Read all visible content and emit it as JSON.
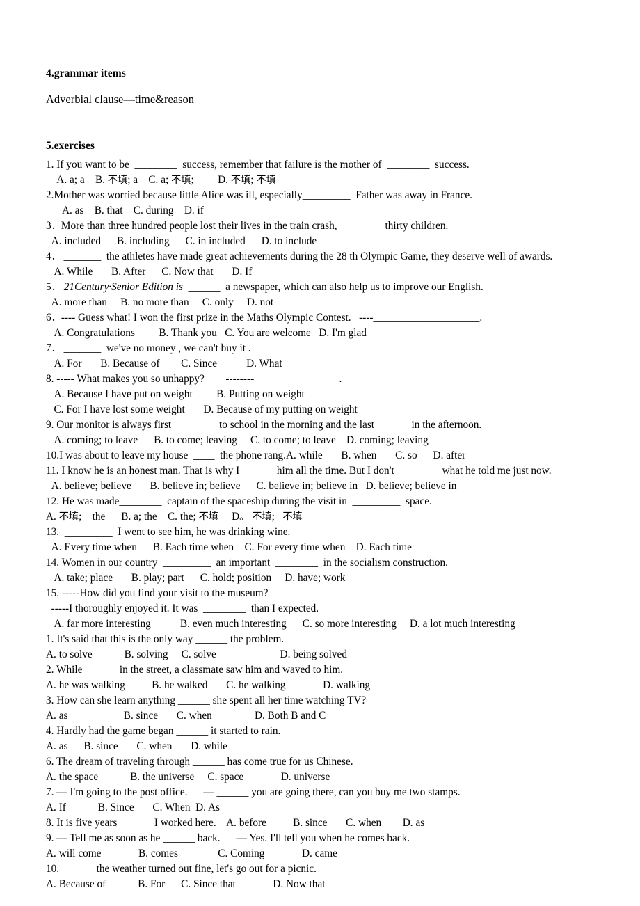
{
  "document": {
    "section_heading": "4.grammar items",
    "section_subheading": "Adverbial clause—time&reason",
    "exercises_heading": "5.exercises",
    "lines": [
      "1. If you want to be  ________  success, remember that failure is the mother of  ________  success.",
      "    A. a; a    B. 不填; a    C. a; 不填;         D. 不填; 不填",
      "2.Mother was worried because little Alice was ill, especially_________  Father was away in France.",
      "      A. as    B. that    C. during    D. if",
      "3．More than three hundred people lost their lives in the train crash,________  thirty children.",
      "  A. included      B. including      C. in included      D. to include",
      "4． _______  the athletes have made great achievements during the 28 th Olympic Game, they deserve well of awards.",
      "   A. While       B. After      C. Now that       D. If",
      "5． 21Century·Senior Edition is  ______  a newspaper, which can also help us to improve our English.",
      "  A. more than     B. no more than     C. only     D. not",
      "6．---- Guess what! I won the first prize in the Maths Olympic Contest.   ----____________________.",
      "   A. Congratulations         B. Thank you   C. You are welcome   D. I'm glad",
      "7． _______  we've no money , we can't buy it .",
      "   A. For       B. Because of        C. Since           D. What",
      "8. ----- What makes you so unhappy?        --------  _______________.",
      "   A. Because I have put on weight         B. Putting on weight",
      "   C. For I have lost some weight       D. Because of my putting on weight",
      "9. Our monitor is always first  _______  to school in the morning and the last  _____  in the afternoon.",
      "   A. coming; to leave      B. to come; leaving     C. to come; to leave    D. coming; leaving",
      "10.I was about to leave my house  ____  the phone rang.A. while       B. when       C. so      D. after",
      "11. I know he is an honest man. That is why I  ______him all the time. But I don't  _______  what he told me just now.",
      "  A. believe; believe       B. believe in; believe      C. believe in; believe in   D. believe; believe in",
      "12. He was made________  captain of the spaceship during the visit in  _________  space.",
      "A. 不填;    the      B. a; the    C. the; 不填     D。 不填;   不填",
      "13.  _________  I went to see him, he was drinking wine.",
      "  A. Every time when      B. Each time when    C. For every time when    D. Each time",
      "14. Women in our country  _________  an important  ________  in the socialism construction.",
      "   A. take; place       B. play; part      C. hold; position     D. have; work",
      "15. -----How did you find your visit to the museum?",
      "  -----I thoroughly enjoyed it. It was  ________  than I expected.",
      "   A. far more interesting           B. even much interesting      C. so more interesting     D. a lot much interesting",
      "1. It's said that this is the only way ______ the problem.",
      "A. to solve            B. solving     C. solve                        D. being solved",
      "2. While ______ in the street, a classmate saw him and waved to him.",
      "A. he was walking          B. he walked       C. he walking              D. walking",
      "3. How can she learn anything ______ she spent all her time watching TV?",
      "A. as                     B. since       C. when                D. Both B and C",
      "4. Hardly had the game began ______ it started to rain.",
      "A. as      B. since       C. when       D. while",
      "6. The dream of traveling through ______ has come true for us Chinese.",
      "A. the space            B. the universe     C. space              D. universe",
      "7. — I'm going to the post office.      — ______ you are going there, can you buy me two stamps.",
      "A. If            B. Since       C. When  D. As",
      "8. It is five years ______ I worked here.    A. before          B. since       C. when        D. as",
      "9. — Tell me as soon as he ______ back.      — Yes. I'll tell you when he comes back.",
      "A. will come              B. comes               C. Coming              D. came",
      "10. ______ the weather turned out fine, let's go out for a picnic.",
      "A. Because of            B. For      C. Since that              D. Now that"
    ]
  }
}
